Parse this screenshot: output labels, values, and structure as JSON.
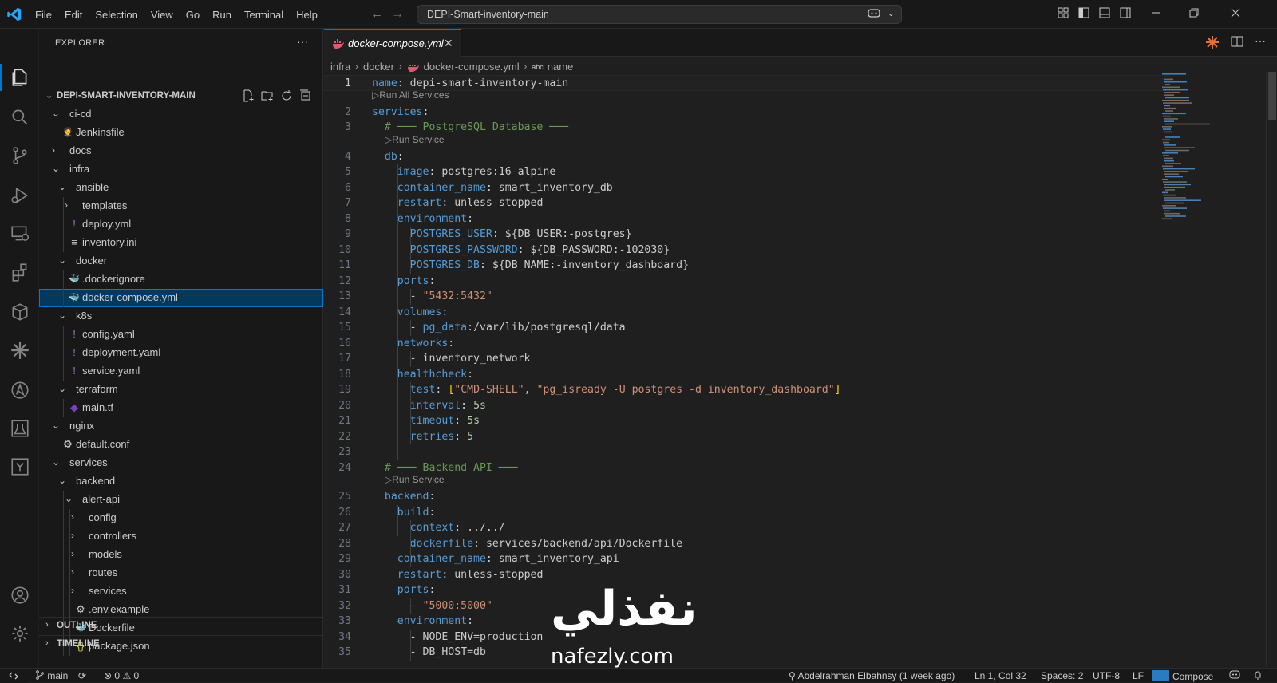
{
  "titlebar": {
    "menu": [
      "File",
      "Edit",
      "Selection",
      "View",
      "Go",
      "Run",
      "Terminal",
      "Help"
    ],
    "search_text": "DEPI-Smart-inventory-main"
  },
  "activity_bar": {
    "icons": [
      "explorer-icon",
      "search-icon",
      "source-control-icon",
      "run-debug-icon",
      "remote-explorer-icon",
      "extensions-icon",
      "containers-icon",
      "copilot-icon",
      "ansible-icon",
      "testing-icon",
      "chat-icon",
      "account-icon",
      "settings-gear-icon"
    ]
  },
  "sidebar": {
    "title": "EXPLORER",
    "dots": "···",
    "project": "DEPI-SMART-INVENTORY-MAIN",
    "tree": [
      {
        "label": "ci-cd",
        "type": "folder",
        "open": true
      },
      {
        "label": "Jenkinsfile",
        "type": "jenkins"
      },
      {
        "label": "docs",
        "type": "folder",
        "open": false
      },
      {
        "label": "infra",
        "type": "folder",
        "open": true
      },
      {
        "label": "ansible",
        "type": "folder",
        "open": true
      },
      {
        "label": "templates",
        "type": "folder",
        "open": false
      },
      {
        "label": "deploy.yml",
        "type": "yaml"
      },
      {
        "label": "inventory.ini",
        "type": "ini"
      },
      {
        "label": "docker",
        "type": "folder",
        "open": true
      },
      {
        "label": ".dockerignore",
        "type": "docker"
      },
      {
        "label": "docker-compose.yml",
        "type": "compose"
      },
      {
        "label": "k8s",
        "type": "folder",
        "open": true
      },
      {
        "label": "config.yaml",
        "type": "yaml"
      },
      {
        "label": "deployment.yaml",
        "type": "yaml"
      },
      {
        "label": "service.yaml",
        "type": "yaml"
      },
      {
        "label": "terraform",
        "type": "folder",
        "open": true
      },
      {
        "label": "main.tf",
        "type": "terraform"
      },
      {
        "label": "nginx",
        "type": "folder",
        "open": true
      },
      {
        "label": "default.conf",
        "type": "gear"
      },
      {
        "label": "services",
        "type": "folder",
        "open": true
      },
      {
        "label": "backend",
        "type": "folder",
        "open": true
      },
      {
        "label": "alert-api",
        "type": "folder",
        "open": true
      },
      {
        "label": "config",
        "type": "folder",
        "open": false
      },
      {
        "label": "controllers",
        "type": "folder",
        "open": false
      },
      {
        "label": "models",
        "type": "folder",
        "open": false
      },
      {
        "label": "routes",
        "type": "folder",
        "open": false
      },
      {
        "label": "services",
        "type": "folder",
        "open": false
      },
      {
        "label": ".env.example",
        "type": "gear"
      },
      {
        "label": "Dockerfile",
        "type": "docker"
      },
      {
        "label": "package.json",
        "type": "json"
      }
    ],
    "outline": "OUTLINE",
    "timeline": "TIMELINE"
  },
  "editor": {
    "tab_label": "docker-compose.yml",
    "breadcrumb": [
      "infra",
      "docker",
      "docker-compose.yml",
      "name"
    ],
    "breadcrumb_symbol": "abc",
    "lens_all": "Run All Services",
    "lens_service": "Run Service",
    "lines": [
      {
        "n": "1",
        "t": "name: depi-smart-inventory-main"
      },
      {
        "n": "2",
        "t": "services:"
      },
      {
        "n": "3",
        "t": "  # ─── PostgreSQL Database ───"
      },
      {
        "n": "4",
        "t": "  db:"
      },
      {
        "n": "5",
        "t": "    image: postgres:16-alpine"
      },
      {
        "n": "6",
        "t": "    container_name: smart_inventory_db"
      },
      {
        "n": "7",
        "t": "    restart: unless-stopped"
      },
      {
        "n": "8",
        "t": "    environment:"
      },
      {
        "n": "9",
        "t": "      POSTGRES_USER: ${DB_USER:-postgres}"
      },
      {
        "n": "10",
        "t": "      POSTGRES_PASSWORD: ${DB_PASSWORD:-102030}"
      },
      {
        "n": "11",
        "t": "      POSTGRES_DB: ${DB_NAME:-inventory_dashboard}"
      },
      {
        "n": "12",
        "t": "    ports:"
      },
      {
        "n": "13",
        "t": "      - \"5432:5432\""
      },
      {
        "n": "14",
        "t": "    volumes:"
      },
      {
        "n": "15",
        "t": "      - pg_data:/var/lib/postgresql/data"
      },
      {
        "n": "16",
        "t": "    networks:"
      },
      {
        "n": "17",
        "t": "      - inventory_network"
      },
      {
        "n": "18",
        "t": "    healthcheck:"
      },
      {
        "n": "19",
        "t": "      test: [\"CMD-SHELL\", \"pg_isready -U postgres -d inventory_dashboard\"]"
      },
      {
        "n": "20",
        "t": "      interval: 5s"
      },
      {
        "n": "21",
        "t": "      timeout: 5s"
      },
      {
        "n": "22",
        "t": "      retries: 5"
      },
      {
        "n": "23",
        "t": ""
      },
      {
        "n": "24",
        "t": "  # ─── Backend API ───"
      },
      {
        "n": "25",
        "t": "  backend:"
      },
      {
        "n": "26",
        "t": "    build:"
      },
      {
        "n": "27",
        "t": "      context: ../../"
      },
      {
        "n": "28",
        "t": "      dockerfile: services/backend/api/Dockerfile"
      },
      {
        "n": "29",
        "t": "    container_name: smart_inventory_api"
      },
      {
        "n": "30",
        "t": "    restart: unless-stopped"
      },
      {
        "n": "31",
        "t": "    ports:"
      },
      {
        "n": "32",
        "t": "      - \"5000:5000\""
      },
      {
        "n": "33",
        "t": "    environment:"
      },
      {
        "n": "34",
        "t": "      - NODE_ENV=production"
      },
      {
        "n": "35",
        "t": "      - DB_HOST=db"
      }
    ]
  },
  "statusbar": {
    "branch": "main",
    "errors": "0",
    "warnings": "0",
    "blame": "Abdelrahman Elbahnsy (1 week ago)",
    "position": "Ln 1, Col 32",
    "spaces": "Spaces: 2",
    "encoding": "UTF-8",
    "eol": "LF",
    "language": "Compose"
  },
  "watermark": {
    "arabic": "نفذلي",
    "latin": "nafezly.com"
  },
  "colors": {
    "accent": "#0078d4",
    "yaml_key": "#569cd6",
    "string": "#ce9178",
    "comment": "#6a9955"
  }
}
